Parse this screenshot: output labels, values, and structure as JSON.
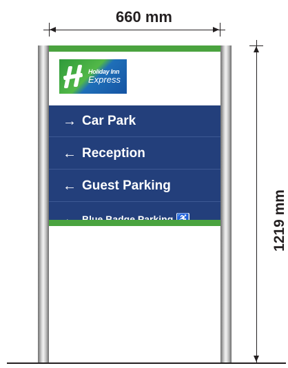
{
  "dimensions": {
    "width_label": "660 mm",
    "height_label": "1219 mm"
  },
  "logo": {
    "brand_text": "Holiday Inn",
    "sub_text": "Express",
    "icon": "holiday-inn-h-logo"
  },
  "sign_rows": [
    {
      "arrow": "→",
      "direction": "right",
      "label": "Car Park"
    },
    {
      "arrow": "←",
      "direction": "left",
      "label": "Reception"
    },
    {
      "arrow": "←",
      "direction": "left",
      "label": "Guest Parking"
    },
    {
      "arrow": "←",
      "direction": "left",
      "label": "Blue Badge Parking",
      "icon": "wheelchair-accessible-icon"
    }
  ],
  "colors": {
    "panel_blue": "#233f7b",
    "accent_green": "#4aa33f",
    "post_silver": "#bdbdbd"
  }
}
